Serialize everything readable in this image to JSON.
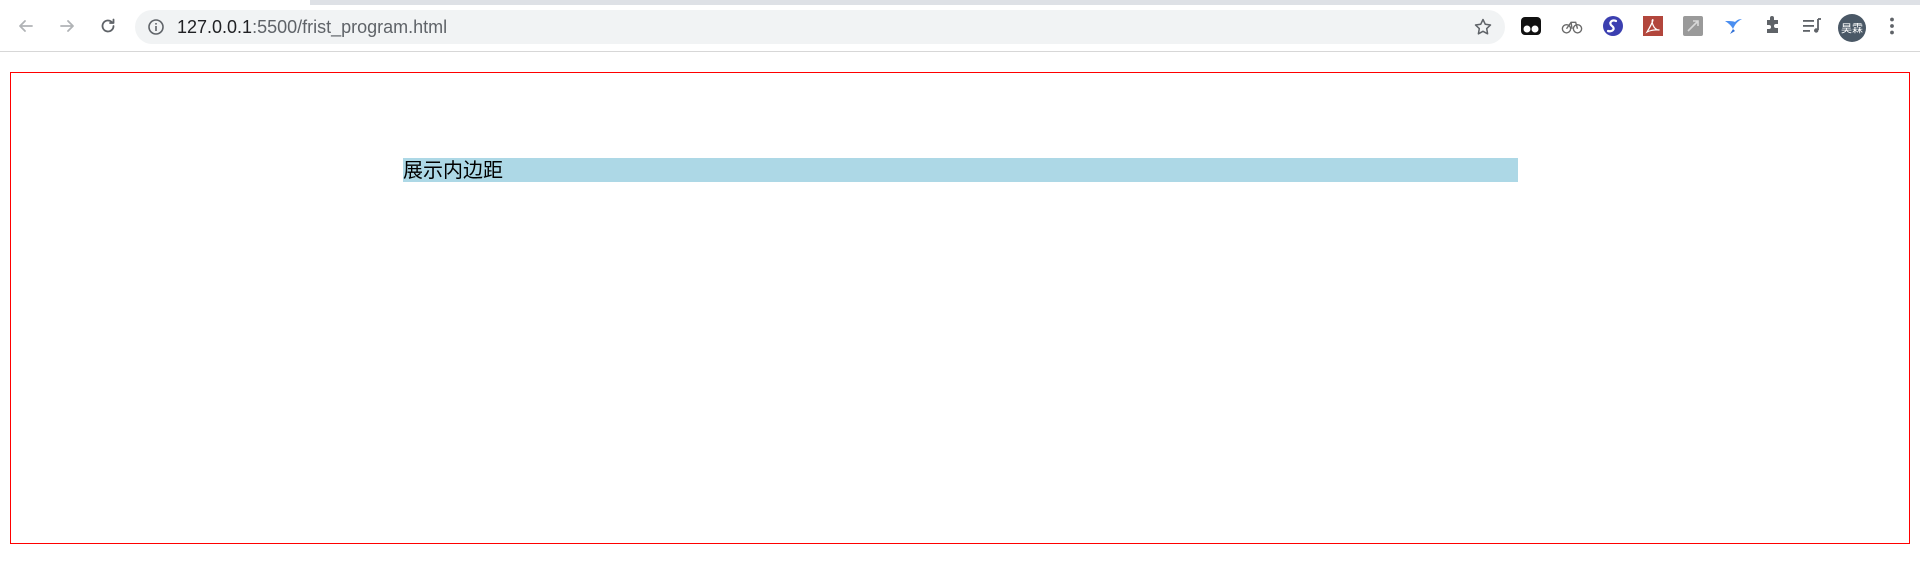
{
  "browser": {
    "url_host": "127.0.0.1",
    "url_rest": ":5500/frist_program.html",
    "nav": {
      "back_icon": "arrow-left-icon",
      "forward_icon": "arrow-right-icon",
      "reload_icon": "reload-icon"
    },
    "extensions": [
      "tampermonkey-icon",
      "bike-icon",
      "s-logo-icon",
      "pdf-icon",
      "grey-extension-icon",
      "bird-icon",
      "puzzle-icon",
      "media-list-icon"
    ],
    "avatar_label": "昊霖",
    "colors": {
      "accent_border": "#ff0000",
      "block_bg": "#add8e6"
    }
  },
  "page": {
    "block_text": "展示内边距"
  }
}
